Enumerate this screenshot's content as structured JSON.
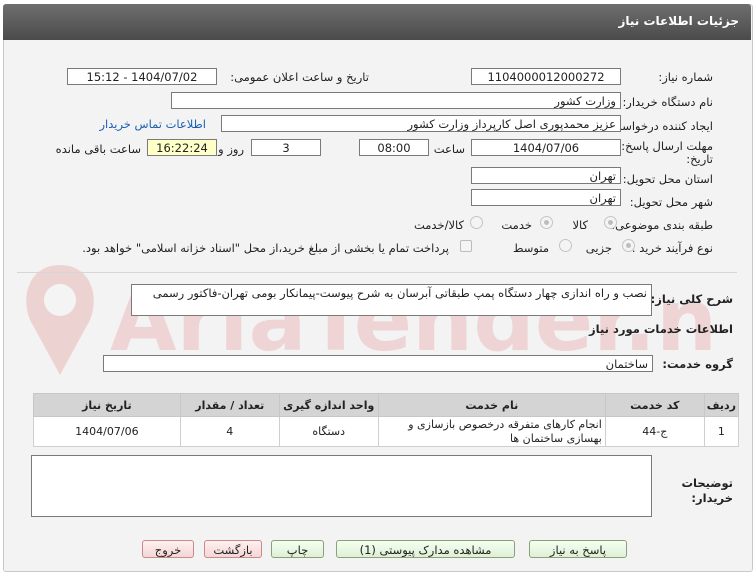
{
  "window": {
    "title": "جزئیات اطلاعات نیاز"
  },
  "form": {
    "need_number_label": "شماره نیاز:",
    "need_number": "1104000012000272",
    "announce_label": "تاریخ و ساعت اعلان عمومی:",
    "announce_value": "1404/07/02 - 15:12",
    "buyer_label": "نام دستگاه خریدار:",
    "buyer_value": "وزارت کشور",
    "creator_label": "ایجاد کننده درخواست:",
    "creator_value": "عزیز محمدپوری اصل کارپرداز وزارت کشور",
    "contact_link": "اطلاعات تماس خریدار",
    "deadline_label_1": "مهلت ارسال پاسخ: تا",
    "deadline_label_2": "تاریخ:",
    "deadline_date": "1404/07/06",
    "time_label": "ساعت",
    "deadline_time": "08:00",
    "days_value": "3",
    "days_label": "روز و",
    "remaining_time": "16:22:24",
    "remaining_label": "ساعت باقی مانده",
    "province_label": "استان محل تحویل:",
    "province_value": "تهران",
    "city_label": "شهر محل تحویل:",
    "city_value": "تهران",
    "category_label": "طبقه بندی موضوعی:",
    "category_options": [
      "کالا",
      "خدمت",
      "کالا/خدمت"
    ],
    "purchase_type_label": "نوع فرآیند خرید :",
    "purchase_options": [
      "جزیی",
      "متوسط"
    ],
    "payment_note": "پرداخت تمام یا بخشی از مبلغ خرید،از محل \"اسناد خزانه اسلامی\" خواهد بود."
  },
  "summary": {
    "label": "شرح کلی نیاز:",
    "value": "نصب و راه اندازی چهار دستگاه پمپ طبقاتی آبرسان به شرح پیوست-پیمانکار بومی تهران-فاکتور رسمی"
  },
  "services": {
    "section_title": "اطلاعات خدمات مورد نیاز",
    "group_label": "گروه خدمت:",
    "group_value": "ساختمان",
    "columns": [
      "ردیف",
      "کد خدمت",
      "نام خدمت",
      "واحد اندازه گیری",
      "تعداد / مقدار",
      "تاریخ نیاز"
    ],
    "rows": [
      [
        "1",
        "ج-44",
        "انجام کارهای متفرقه درخصوص بازسازی و بهسازی ساختمان ها",
        "دستگاه",
        "4",
        "1404/07/06"
      ]
    ]
  },
  "notes": {
    "label_1": "توضیحات",
    "label_2": "خریدار:"
  },
  "buttons": {
    "reply": "پاسخ به نیاز",
    "attachments": "مشاهده مدارک پیوستی (1)",
    "print": "چاپ",
    "back": "بازگشت",
    "exit": "خروج"
  },
  "watermark": {
    "text": "AriaTender.net"
  }
}
